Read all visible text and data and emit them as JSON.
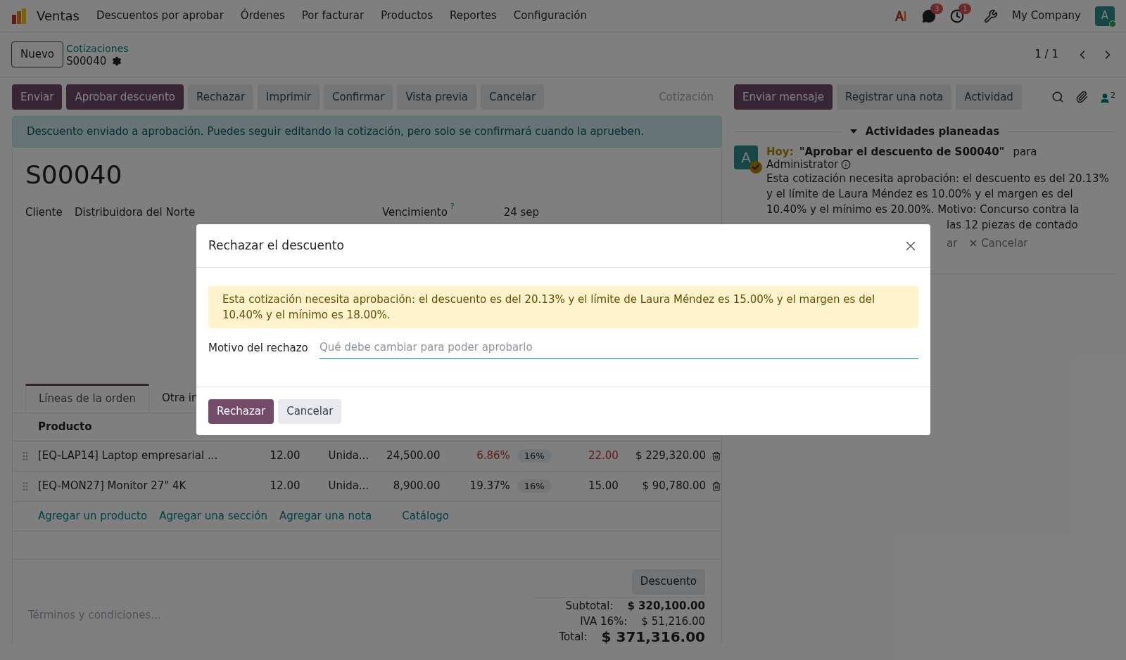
{
  "navbar": {
    "app": "Ventas",
    "menu": [
      "Descuentos por aprobar",
      "Órdenes",
      "Por facturar",
      "Productos",
      "Reportes",
      "Configuración"
    ],
    "messages_badge": "3",
    "activities_badge": "1",
    "company": "My Company",
    "avatar": "A"
  },
  "control_panel": {
    "new_button": "Nuevo",
    "breadcrumb": "Cotizaciones",
    "record": "S00040",
    "pager": "1 / 1"
  },
  "actions": [
    {
      "label": "Enviar",
      "primary": true
    },
    {
      "label": "Aprobar descuento",
      "primary": true
    },
    {
      "label": "Rechazar",
      "primary": false
    },
    {
      "label": "Imprimir",
      "primary": false
    },
    {
      "label": "Confirmar",
      "primary": false
    },
    {
      "label": "Vista previa",
      "primary": false
    },
    {
      "label": "Cancelar",
      "primary": false
    }
  ],
  "status": "Cotización",
  "alert": "Descuento enviado a aprobación. Puedes seguir editando la cotización, pero solo se confirmará cuando la aprueben.",
  "form": {
    "title": "S00040",
    "customer_label": "Cliente",
    "customer": "Distribuidora del Norte",
    "due_label": "Vencimiento",
    "due_help": "?",
    "due": "24 sep",
    "tabs": [
      {
        "label": "Líneas de la orden",
        "selected": true
      },
      {
        "label": "Otra in",
        "selected": false
      }
    ],
    "table": {
      "columns": [
        "Producto"
      ],
      "rows": [
        {
          "product": "[EQ-LAP14] Laptop empresarial ...",
          "quantity": "12.00",
          "unit": "Unida...",
          "price": "24,500.00",
          "discount": "6.86%",
          "tax": "16%",
          "column_7": "22.00",
          "subtotal": "$ 229,320.00",
          "flagged": true
        },
        {
          "product": "[EQ-MON27] Monitor 27\" 4K",
          "quantity": "12.00",
          "unit": "Unida...",
          "price": "8,900.00",
          "discount": "19.37%",
          "tax": "16%",
          "column_7": "15.00",
          "subtotal": "$ 90,780.00",
          "flagged": false
        }
      ],
      "add_links": [
        "Agregar un producto",
        "Agregar una sección",
        "Agregar una nota",
        "Catálogo"
      ]
    },
    "terms_placeholder": "Términos y condiciones...",
    "discount_button": "Descuento",
    "totals": [
      {
        "label": "Subtotal:",
        "value": "$ 320,100.00",
        "kind": "bold"
      },
      {
        "label": "IVA 16%:",
        "value": "$ 51,216.00",
        "kind": "plain"
      },
      {
        "label": "Total:",
        "value": "$ 371,316.00",
        "kind": "grand"
      }
    ]
  },
  "chatter": {
    "buttons": [
      {
        "label": "Enviar mensaje",
        "primary": true
      },
      {
        "label": "Registrar una nota",
        "primary": false
      },
      {
        "label": "Actividad",
        "primary": false
      }
    ],
    "followers": "2",
    "section": "Actividades planeadas",
    "activity": {
      "avatar": "A",
      "when": "Hoy:",
      "title": "\"Aprobar el descuento de S00040\"",
      "for": "para",
      "user": "Administrator",
      "note": "Esta cotización necesita aprobación: el descuento es del 20.13% y el límite de Laura Méndez es 10.00% y el margen es del 10.40% y el mínimo es 20.00%. Motivo: Concurso contra la",
      "note_tail": "las 12 piezas de contado",
      "action_tail": "ar",
      "cancel": "Cancelar"
    }
  },
  "dialog": {
    "title": "Rechazar el descuento",
    "warning": "Esta cotización necesita aprobación: el descuento es del 20.13% y el límite de Laura Méndez es 15.00% y el margen es del 10.40% y el mínimo es 18.00%.",
    "field_label": "Motivo del rechazo",
    "placeholder": "Qué debe cambiar para poder aprobarlo",
    "buttons": [
      {
        "label": "Rechazar",
        "primary": true
      },
      {
        "label": "Cancelar",
        "primary": false
      }
    ]
  }
}
